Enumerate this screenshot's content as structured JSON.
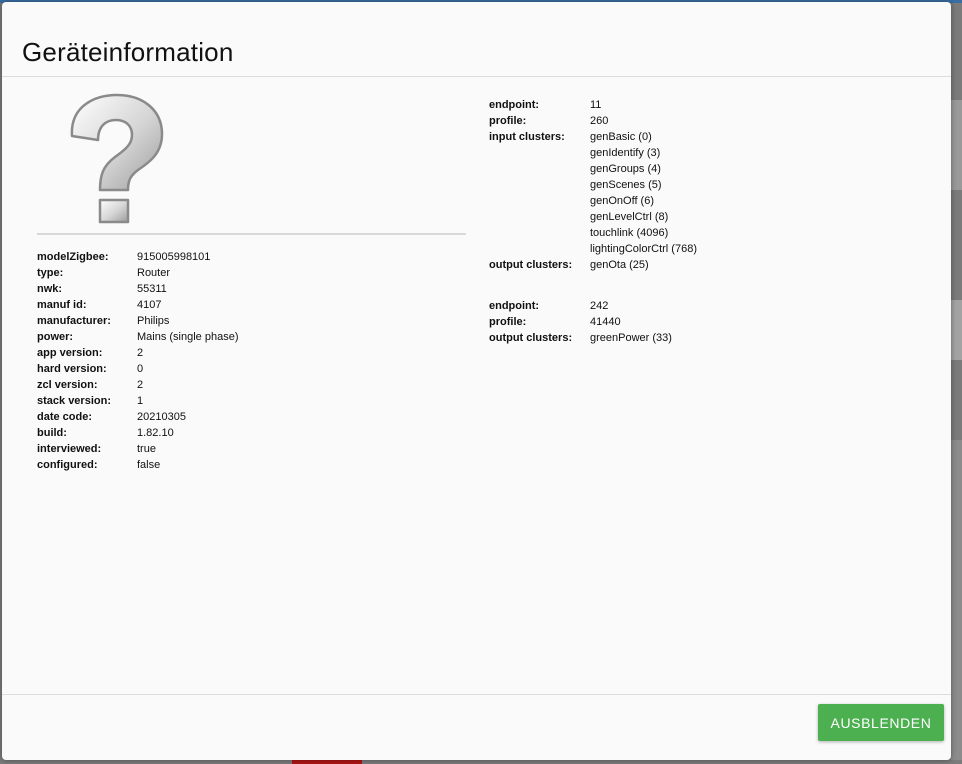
{
  "dialog": {
    "title": "Geräteinformation",
    "image_icon": "question-mark-icon",
    "hide_button_label": "AUSBLENDEN",
    "accent_color": "#4caf50"
  },
  "device_info": [
    {
      "label": "modelZigbee:",
      "value": "915005998101"
    },
    {
      "label": "type:",
      "value": "Router"
    },
    {
      "label": "nwk:",
      "value": "55311"
    },
    {
      "label": "manuf id:",
      "value": "4107"
    },
    {
      "label": "manufacturer:",
      "value": "Philips"
    },
    {
      "label": "power:",
      "value": "Mains (single phase)"
    },
    {
      "label": "app version:",
      "value": "2"
    },
    {
      "label": "hard version:",
      "value": "0"
    },
    {
      "label": "zcl version:",
      "value": "2"
    },
    {
      "label": "stack version:",
      "value": "1"
    },
    {
      "label": "date code:",
      "value": "20210305"
    },
    {
      "label": "build:",
      "value": "1.82.10"
    },
    {
      "label": "interviewed:",
      "value": "true"
    },
    {
      "label": "configured:",
      "value": "false"
    }
  ],
  "endpoints": [
    {
      "rows": [
        {
          "label": "endpoint:",
          "value": "11"
        },
        {
          "label": "profile:",
          "value": "260"
        },
        {
          "label": "input clusters:",
          "value": "genBasic (0)"
        },
        {
          "label": "",
          "value": "genIdentify (3)"
        },
        {
          "label": "",
          "value": "genGroups (4)"
        },
        {
          "label": "",
          "value": "genScenes (5)"
        },
        {
          "label": "",
          "value": "genOnOff (6)"
        },
        {
          "label": "",
          "value": "genLevelCtrl (8)"
        },
        {
          "label": "",
          "value": "touchlink (4096)"
        },
        {
          "label": "",
          "value": "lightingColorCtrl (768)"
        },
        {
          "label": "output clusters:",
          "value": "genOta (25)"
        }
      ]
    },
    {
      "rows": [
        {
          "label": "endpoint:",
          "value": "242"
        },
        {
          "label": "profile:",
          "value": "41440"
        },
        {
          "label": "output clusters:",
          "value": "greenPower (33)"
        }
      ]
    }
  ]
}
